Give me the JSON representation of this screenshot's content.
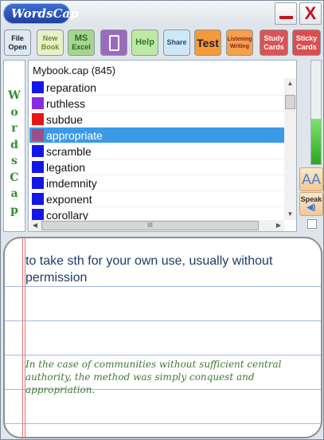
{
  "app": {
    "logo_text": "WordsCap"
  },
  "window_buttons": {
    "minimize_icon": "minimize-icon",
    "close_label": "X"
  },
  "toolbar": [
    {
      "name": "file-open-button",
      "lines": [
        "File",
        "Open"
      ],
      "bg": "#dfe9f2",
      "fg": "#222222"
    },
    {
      "name": "new-book-button",
      "lines": [
        "New",
        "Book"
      ],
      "bg": "#e9f0c9",
      "fg": "#6d8d2a"
    },
    {
      "name": "ms-excel-button",
      "lines": [
        "MS",
        "Excel"
      ],
      "bg": "#a8d58b",
      "fg": "#1d6b2c"
    },
    {
      "name": "phone-button",
      "lines": [],
      "bg": "#9a6bbd",
      "fg": "#ffffff"
    },
    {
      "name": "help-button",
      "lines": [
        "Help"
      ],
      "bg": "#bfe8a4",
      "fg": "#2f7a2f"
    },
    {
      "name": "share-button",
      "lines": [
        "Share"
      ],
      "bg": "#cfe8f6",
      "fg": "#1f4c7a"
    },
    {
      "name": "test-button",
      "lines": [
        "Test"
      ],
      "bg": "#f29a3c",
      "fg": "#222222"
    },
    {
      "name": "listening-writing-button",
      "lines": [
        "Listening",
        "Writing"
      ],
      "bg": "#f5a04a",
      "fg": "#8a1c1c"
    },
    {
      "name": "study-cards-button",
      "lines": [
        "Study",
        "Cards"
      ],
      "bg": "#d85555",
      "fg": "#ffffff"
    },
    {
      "name": "sticky-cards-button",
      "lines": [
        "Sticky",
        "Cards"
      ],
      "bg": "#d94f4f",
      "fg": "#ffffff"
    }
  ],
  "side_label": "WordsCap",
  "list": {
    "header": "Mybook.cap (845)",
    "selected_index": 3,
    "items": [
      {
        "word": "reparation",
        "color": "#1515e8"
      },
      {
        "word": "ruthless",
        "color": "#8a2be2"
      },
      {
        "word": "subdue",
        "color": "#e81515"
      },
      {
        "word": "appropriate",
        "color": "#9c4f86"
      },
      {
        "word": "scramble",
        "color": "#1515e8"
      },
      {
        "word": "legation",
        "color": "#1515e8"
      },
      {
        "word": "imdemnity",
        "color": "#1515e8"
      },
      {
        "word": "exponent",
        "color": "#1515e8"
      },
      {
        "word": "corollary",
        "color": "#1515e8"
      }
    ],
    "hscroll_thumb": "III"
  },
  "level_meter": {
    "fill_fraction": 0.44
  },
  "controls": {
    "font_label": "AA",
    "speak_label": "Speak",
    "speaker_icon": "speaker-icon"
  },
  "card": {
    "definition": "to take sth for your own use, usually without permission",
    "example": "In the case of communities without sufficient central authority, the method was simply conquest and appropriation."
  }
}
